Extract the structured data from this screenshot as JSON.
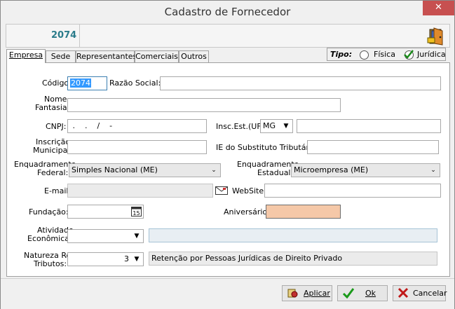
{
  "window": {
    "title": "Cadastro de Fornecedor",
    "close_glyph": "✕"
  },
  "header": {
    "code": "2074",
    "icon": "exit-door-icon"
  },
  "tabs": [
    {
      "label": "Empresa",
      "active": true
    },
    {
      "label": "Sede",
      "active": false
    },
    {
      "label": "Representantes",
      "active": false
    },
    {
      "label": "Comerciais",
      "active": false
    },
    {
      "label": "Outros",
      "active": false
    }
  ],
  "tipo": {
    "label": "Tipo:",
    "fisica": "Física",
    "juridica": "Jurídica",
    "selected": "Jurídica"
  },
  "form": {
    "codigo": {
      "label": "Código:",
      "value": "2074"
    },
    "razao_social": {
      "label": "Razão Social:",
      "value": ""
    },
    "nome_fantasia": {
      "label1": "Nome",
      "label2": "Fantasia:",
      "value": ""
    },
    "cnpj": {
      "label": "CNPJ:",
      "value": " .    .    /    -"
    },
    "insc_est": {
      "label": "Insc.Est.(UF):",
      "uf": "MG",
      "value": ""
    },
    "insc_municipal": {
      "label1": "Inscrição",
      "label2": "Municipal:",
      "value": ""
    },
    "ie_substituto": {
      "label": "IE do Substituto Tributário:",
      "value": ""
    },
    "enq_federal": {
      "label1": "Enquadramento",
      "label2": "Federal:",
      "value": "Simples Nacional (ME)"
    },
    "enq_estadual": {
      "label1": "Enquadramento",
      "label2": "Estadual:",
      "value": "Microempresa (ME)"
    },
    "email": {
      "label": "E-mail:",
      "value": ""
    },
    "website": {
      "label": "WebSite:",
      "value": ""
    },
    "fundacao": {
      "label": "Fundação:",
      "value": ""
    },
    "aniversario": {
      "label": "Aniversário:",
      "value": ""
    },
    "atividade": {
      "label1": "Atividade",
      "label2": "Econômica:",
      "value": "",
      "description": ""
    },
    "natureza": {
      "label1": "Natureza Ret.",
      "label2": "Tributos:",
      "value": "3",
      "description": "Retenção por Pessoas Jurídicas de Direito Privado"
    }
  },
  "buttons": {
    "aplicar": "Aplicar",
    "ok": "Ok",
    "cancelar": "Cancelar"
  },
  "colors": {
    "code_color": "#2a7b8a",
    "close_bg": "#c75050",
    "peach_field": "#f5c8a8"
  }
}
